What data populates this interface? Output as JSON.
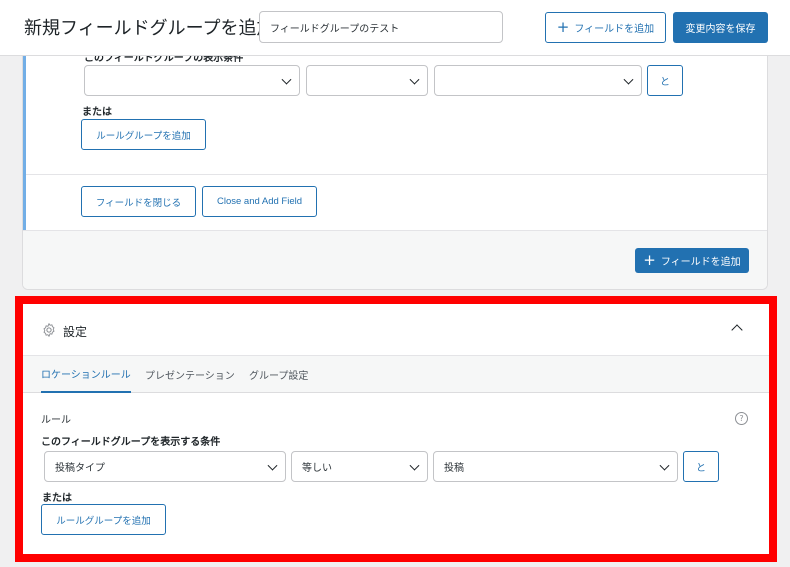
{
  "header": {
    "title": "新規フィールドグループを追加",
    "group_name_value": "フィールドグループのテスト",
    "add_field_label": "フィールドを追加",
    "save_label": "変更内容を保存"
  },
  "field_editor": {
    "cut_off_label": "このフィールドグループの表示条件",
    "rule_selects": [
      "",
      "",
      ""
    ],
    "and_label": "と",
    "or_label": "または",
    "add_rule_group_label": "ルールグループを追加",
    "close_field_label": "フィールドを閉じる",
    "close_and_add_label": "Close and Add Field",
    "footer_add_field_label": "フィールドを追加"
  },
  "settings": {
    "title": "設定",
    "tabs": [
      {
        "label": "ロケーションルール",
        "active": true
      },
      {
        "label": "プレゼンテーション",
        "active": false
      },
      {
        "label": "グループ設定",
        "active": false
      }
    ],
    "rules_label": "ルール",
    "help_symbol": "?",
    "condition_label": "このフィールドグループを表示する条件",
    "rule": {
      "param": "投稿タイプ",
      "operator": "等しい",
      "value": "投稿"
    },
    "and_label": "と",
    "or_label": "または",
    "add_rule_group_label": "ルールグループを追加"
  },
  "colors": {
    "accent": "#2271b1",
    "highlight_border": "#ff0000",
    "field_border": "#72aee6"
  }
}
